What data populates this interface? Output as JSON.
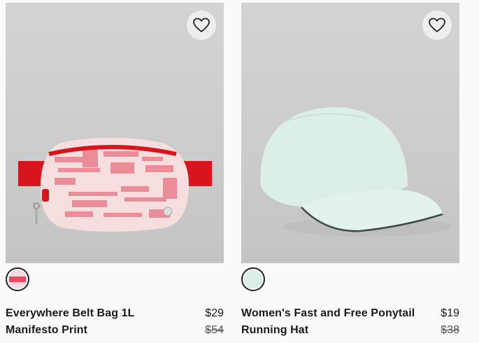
{
  "products": [
    {
      "name": "Everywhere Belt Bag 1L Manifesto Print",
      "price": "$29",
      "original_price": "$54",
      "image_alt": "belt-bag-image",
      "swatch_color": "#e84a5f",
      "favorite_icon": "heart-outline-icon"
    },
    {
      "name": "Women's Fast and Free Ponytail Running Hat",
      "price": "$19",
      "original_price": "$38",
      "image_alt": "running-hat-image",
      "swatch_color": "#dcefe6",
      "favorite_icon": "heart-outline-icon"
    }
  ]
}
